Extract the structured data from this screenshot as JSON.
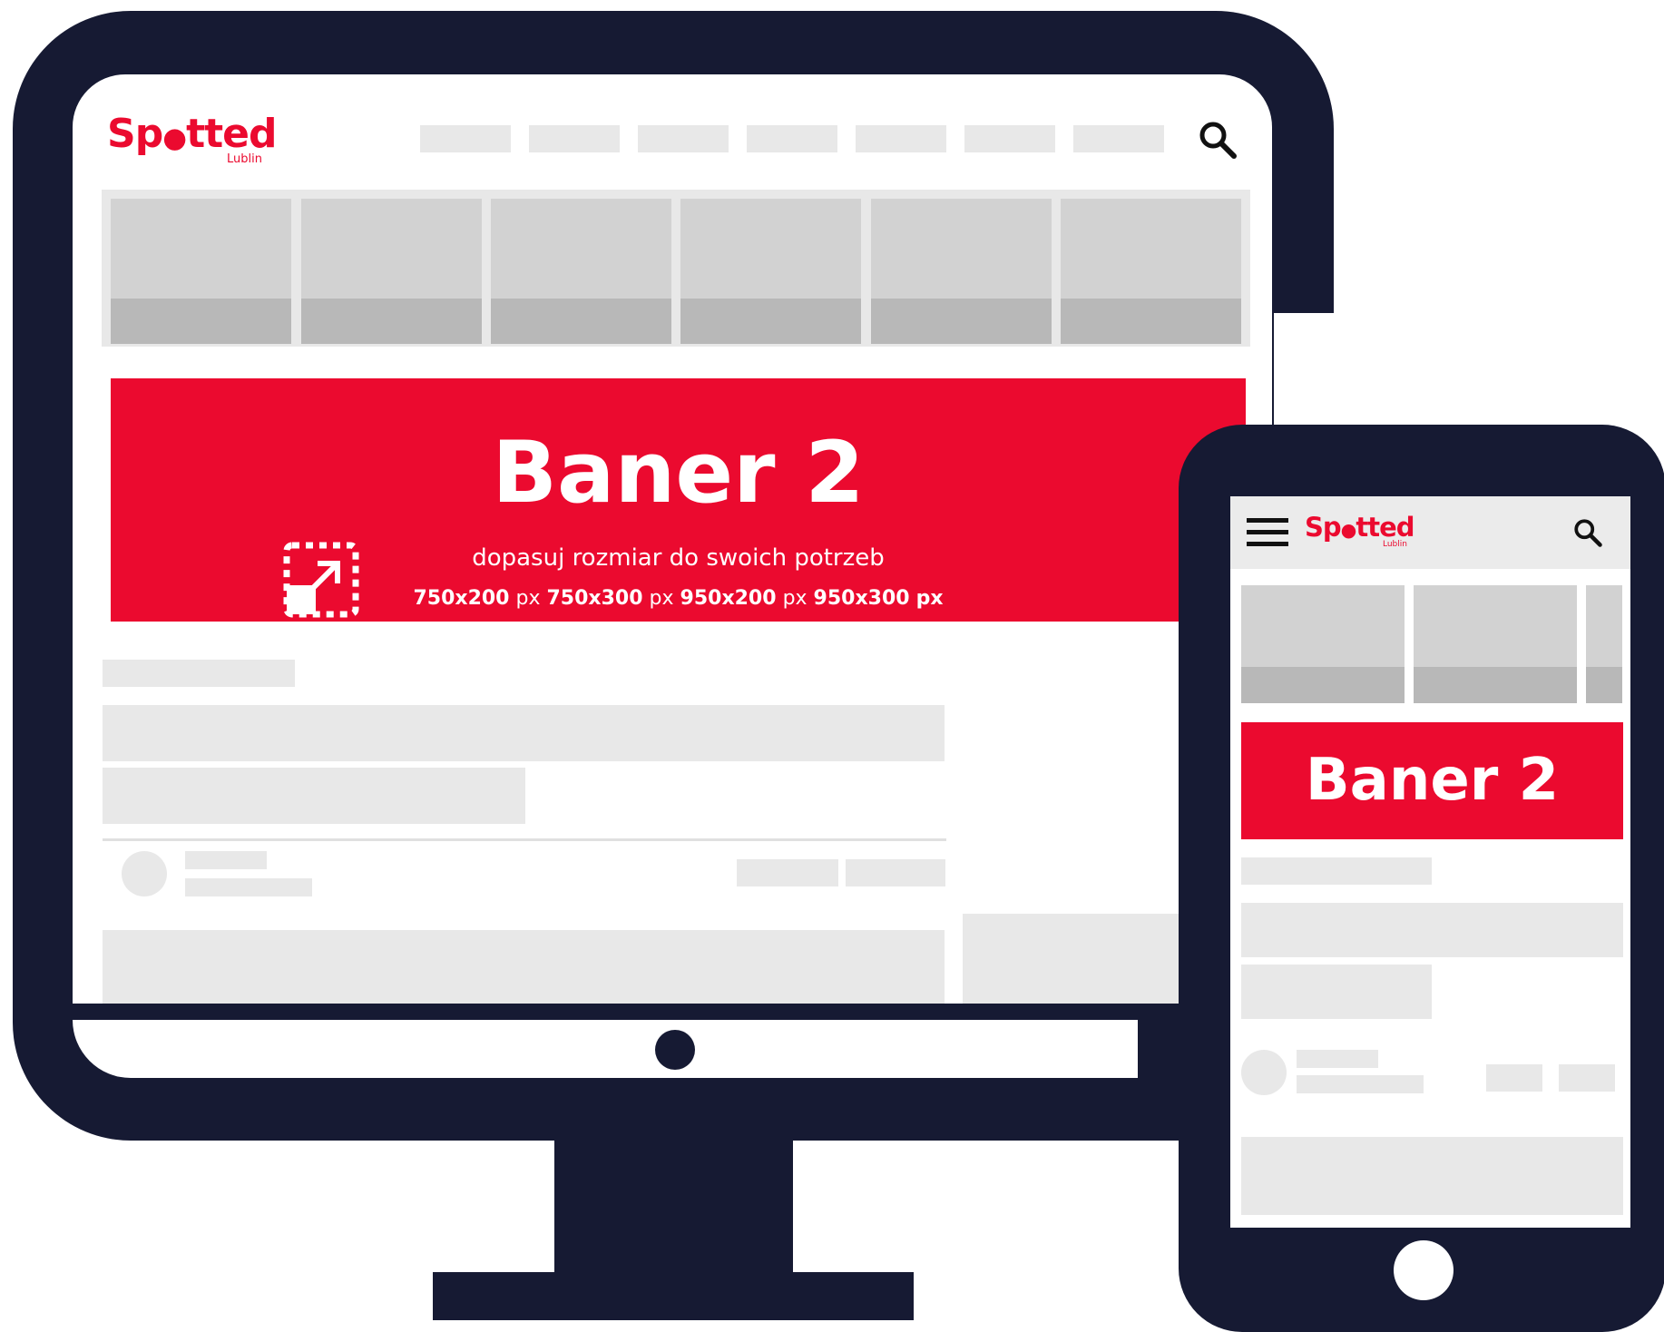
{
  "brand": {
    "name": "Spotted",
    "city": "Lublin",
    "accent": "#eb0a2f",
    "device_color": "#161a33"
  },
  "banner": {
    "title": "Baner 2",
    "subtitle": "dopasuj rozmiar do swoich potrzeb",
    "sizes": [
      {
        "value": "750x200",
        "unit": "px"
      },
      {
        "value": "750x300",
        "unit": "px"
      },
      {
        "value": "950x200",
        "unit": "px"
      },
      {
        "value": "950x300",
        "unit": "px"
      }
    ]
  },
  "icons": {
    "search": "search-icon",
    "menu": "hamburger-menu-icon",
    "resize": "resize-icon"
  }
}
